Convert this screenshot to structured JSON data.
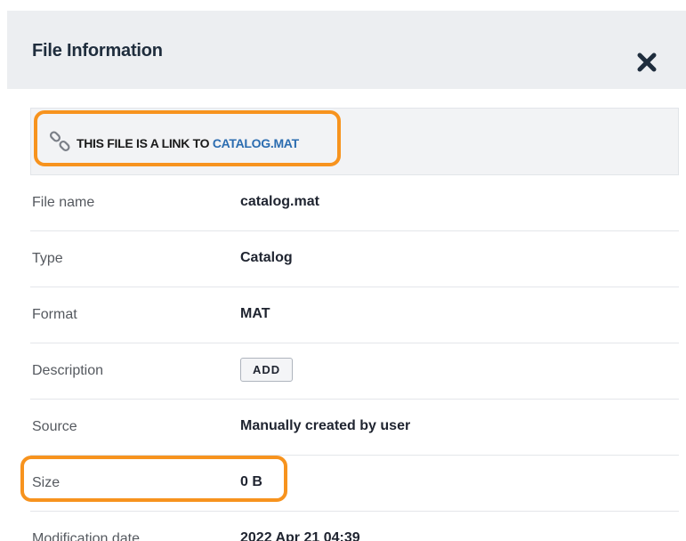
{
  "header": {
    "title": "File Information",
    "close_icon": "close-x-icon"
  },
  "link_notice": {
    "icon": "chain-link-icon",
    "prefix": "THIS FILE IS A LINK TO",
    "target": "CATALOG.MAT"
  },
  "rows": [
    {
      "label": "File name",
      "value": "catalog.mat"
    },
    {
      "label": "Type",
      "value": "Catalog"
    },
    {
      "label": "Format",
      "value": "MAT"
    },
    {
      "label": "Description",
      "button": "ADD"
    },
    {
      "label": "Source",
      "value": "Manually created by user"
    },
    {
      "label": "Size",
      "value": "0 B"
    },
    {
      "label": "Modification date",
      "value": "2022 Apr 21 04:39"
    }
  ],
  "colors": {
    "accent_highlight": "#f7931e",
    "link": "#2b6cb0",
    "header_bg": "#eceef1"
  }
}
